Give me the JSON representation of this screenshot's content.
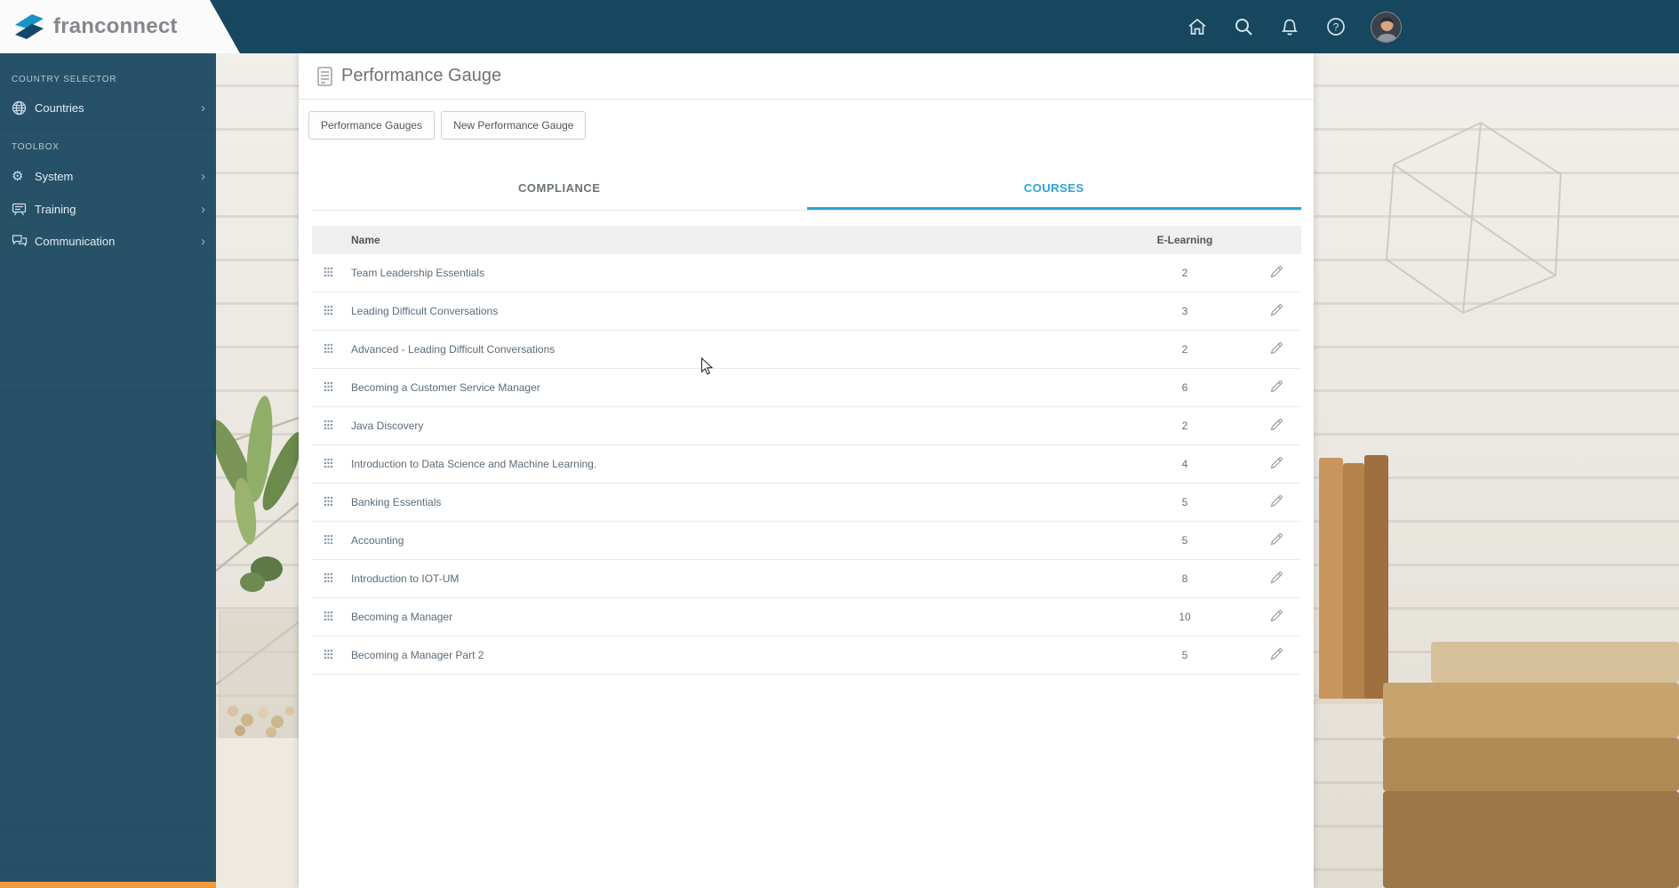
{
  "header": {
    "logo": "franconnect",
    "help_glyph": "?",
    "icons": [
      "home-icon",
      "search-icon",
      "bell-icon",
      "help-icon",
      "avatar"
    ]
  },
  "sidebar": {
    "sections": [
      {
        "label": "COUNTRY SELECTOR",
        "items": [
          {
            "label": "Countries",
            "icon": "globe-icon"
          }
        ]
      },
      {
        "label": "TOOLBOX",
        "items": [
          {
            "label": "System",
            "icon": "gear-icon"
          },
          {
            "label": "Training",
            "icon": "presentation-icon"
          },
          {
            "label": "Communication",
            "icon": "chat-bubbles-icon"
          }
        ]
      }
    ]
  },
  "page": {
    "title": "Performance Gauge",
    "toolbar_buttons": [
      "Performance Gauges",
      "New Performance Gauge"
    ],
    "tabs": [
      {
        "label": "COMPLIANCE",
        "active": false
      },
      {
        "label": "COURSES",
        "active": true
      }
    ],
    "table": {
      "columns": [
        "Name",
        "E-Learning"
      ],
      "rows": [
        {
          "name": "Team Leadership Essentials",
          "elearning": "2"
        },
        {
          "name": "Leading Difficult Conversations",
          "elearning": "3"
        },
        {
          "name": "Advanced - Leading Difficult Conversations",
          "elearning": "2"
        },
        {
          "name": "Becoming a Customer Service Manager",
          "elearning": "6"
        },
        {
          "name": "Java Discovery",
          "elearning": "2"
        },
        {
          "name": "Introduction to Data Science and Machine Learning.",
          "elearning": "4"
        },
        {
          "name": "Banking Essentials",
          "elearning": "5"
        },
        {
          "name": "Accounting",
          "elearning": "5"
        },
        {
          "name": "Introduction to IOT-UM",
          "elearning": "8"
        },
        {
          "name": "Becoming a Manager",
          "elearning": "10"
        },
        {
          "name": "Becoming a Manager Part 2",
          "elearning": "5"
        }
      ]
    }
  },
  "colors": {
    "header_bg": "#17465f",
    "accent_blue": "#2ba3dd",
    "accent_orange": "#f39b3a",
    "table_header_bg": "#efefef"
  }
}
